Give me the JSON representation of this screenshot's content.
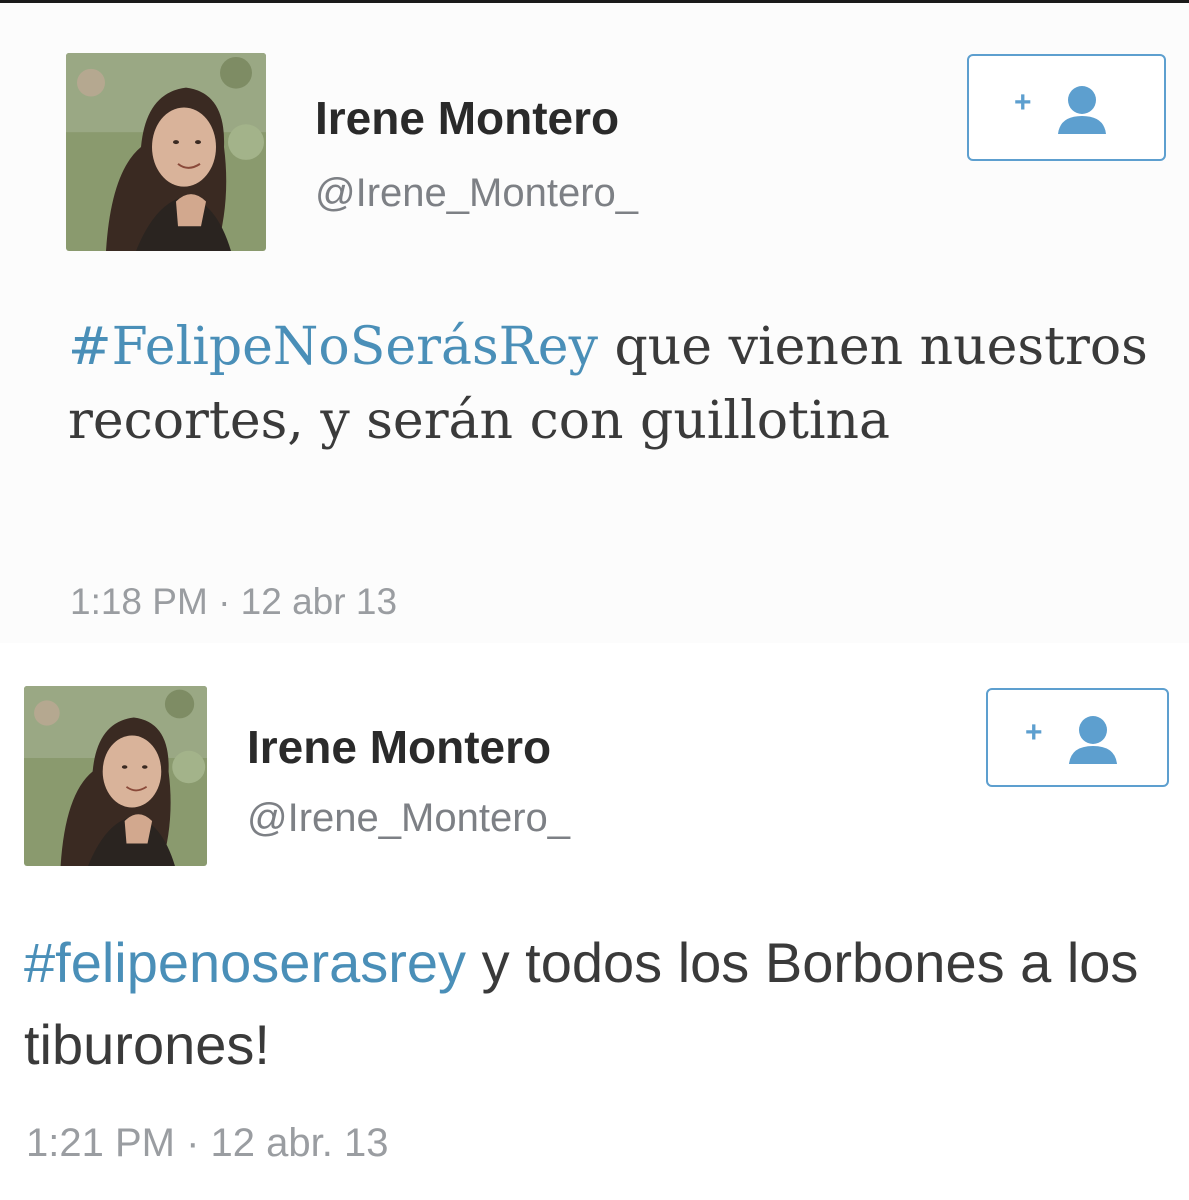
{
  "tweets": [
    {
      "author": {
        "name": "Irene Montero",
        "handle": "@Irene_Montero_"
      },
      "hashtag": "#FelipeNoSerásRey",
      "text": " que vienen nuestros recortes, y serán con guillotina",
      "timestamp": "1:18 PM · 12 abr 13",
      "follow_icon": "add-user-icon"
    },
    {
      "author": {
        "name": "Irene Montero",
        "handle": "@Irene_Montero_"
      },
      "hashtag": "#felipenoserasrey",
      "text": " y todos los Borbones a los tiburones!",
      "timestamp": "1:21 PM · 12 abr. 13",
      "follow_icon": "add-user-icon"
    }
  ],
  "colors": {
    "hashtag": "#4a8fb8",
    "follow_border": "#5d9fcf",
    "name": "#2a2a2a",
    "handle": "#7d8085",
    "timestamp": "#9a9da1"
  }
}
